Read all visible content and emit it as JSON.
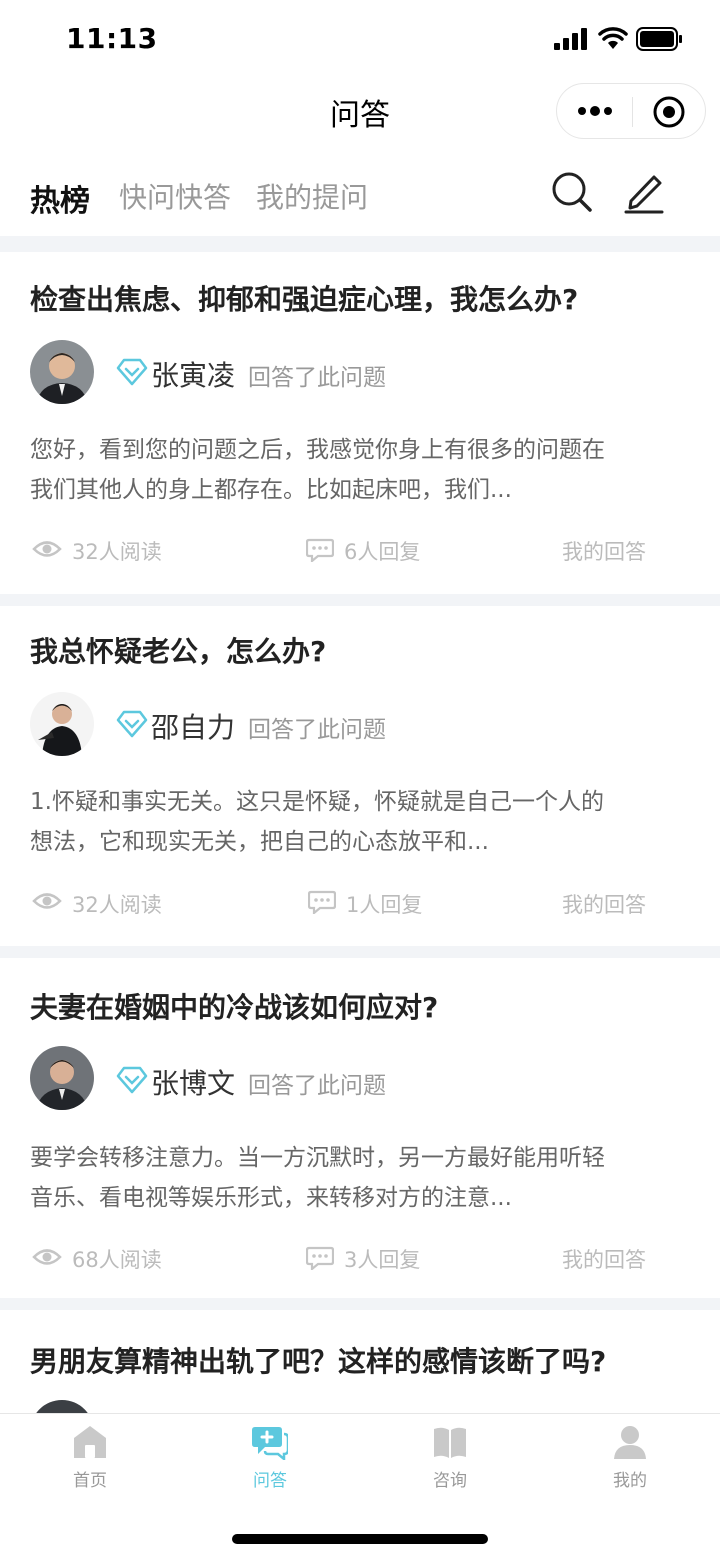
{
  "status": {
    "time": "11:13"
  },
  "nav": {
    "title": "问答"
  },
  "tabs": [
    {
      "label": "热榜",
      "active": true
    },
    {
      "label": "快问快答"
    },
    {
      "label": "我的提问"
    }
  ],
  "colors": {
    "accent": "#5cc8de",
    "muted": "#999999",
    "page_gap": "#f2f4f7"
  },
  "posts": [
    {
      "question": "检查出焦虑、抑郁和强迫症心理，我怎么办?",
      "answerer": "张寅凌",
      "answered_text": "回答了此问题",
      "excerpt_line1": "您好，看到您的问题之后，我感觉你身上有很多的问题在",
      "excerpt_line2": "我们其他人的身上都存在。比如起床吧，我们...",
      "reads": "32人阅读",
      "replies": "6人回复",
      "my_answer": "我的回答"
    },
    {
      "question": "我总怀疑老公，怎么办?",
      "answerer": "邵自力",
      "answered_text": "回答了此问题",
      "excerpt_line1": "1.怀疑和事实无关。这只是怀疑，怀疑就是自己一个人的",
      "excerpt_line2": "想法，它和现实无关，把自己的心态放平和...",
      "reads": "32人阅读",
      "replies": "1人回复",
      "my_answer": "我的回答"
    },
    {
      "question": "夫妻在婚姻中的冷战该如何应对?",
      "answerer": "张博文",
      "answered_text": "回答了此问题",
      "excerpt_line1": "要学会转移注意力。当一方沉默时，另一方最好能用听轻",
      "excerpt_line2": "音乐、看电视等娱乐形式，来转移对方的注意...",
      "reads": "68人阅读",
      "replies": "3人回复",
      "my_answer": "我的回答"
    },
    {
      "question": "男朋友算精神出轨了吧？这样的感情该断了吗?"
    }
  ],
  "tab_bar": [
    {
      "label": "首页",
      "icon": "home-icon"
    },
    {
      "label": "问答",
      "icon": "qa-icon",
      "active": true
    },
    {
      "label": "咨询",
      "icon": "book-icon"
    },
    {
      "label": "我的",
      "icon": "user-icon"
    }
  ]
}
